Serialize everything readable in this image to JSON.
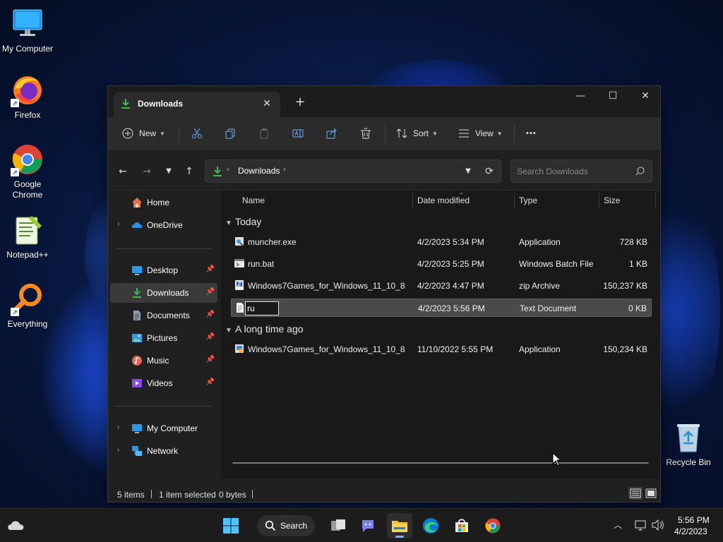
{
  "desktop": {
    "icons": [
      {
        "label": "My Computer"
      },
      {
        "label": "Firefox"
      },
      {
        "label": "Google Chrome"
      },
      {
        "label": "Notepad++"
      },
      {
        "label": "Everything"
      },
      {
        "label": "Recycle Bin"
      }
    ]
  },
  "explorer": {
    "tab_title": "Downloads",
    "tab_close": "✕",
    "new_tab": "+",
    "window_controls": {
      "minimize": "—",
      "maximize": "☐",
      "close": "✕"
    },
    "toolbar": {
      "new_label": "New",
      "sort_label": "Sort",
      "view_label": "View",
      "more_label": "•••"
    },
    "address": {
      "path": "Downloads",
      "search_placeholder": "Search Downloads"
    },
    "sidebar": {
      "items": [
        {
          "label": "Home",
          "icon": "home-icon"
        },
        {
          "label": "OneDrive",
          "icon": "cloud-icon"
        },
        {
          "label": "Desktop",
          "icon": "desktop-icon",
          "pinned": true
        },
        {
          "label": "Downloads",
          "icon": "download-icon",
          "pinned": true,
          "selected": true
        },
        {
          "label": "Documents",
          "icon": "document-icon",
          "pinned": true
        },
        {
          "label": "Pictures",
          "icon": "pictures-icon",
          "pinned": true
        },
        {
          "label": "Music",
          "icon": "music-icon",
          "pinned": true
        },
        {
          "label": "Videos",
          "icon": "videos-icon",
          "pinned": true
        },
        {
          "label": "My Computer",
          "icon": "computer-icon"
        },
        {
          "label": "Network",
          "icon": "network-icon"
        }
      ]
    },
    "columns": [
      "Name",
      "Date modified",
      "Type",
      "Size"
    ],
    "groups": [
      {
        "label": "Today",
        "rows": [
          {
            "name": "muncher.exe",
            "date": "4/2/2023 5:34 PM",
            "type": "Application",
            "size": "728 KB",
            "icon": "exe-icon"
          },
          {
            "name": "run.bat",
            "date": "4/2/2023 5:25 PM",
            "type": "Windows Batch File",
            "size": "1 KB",
            "icon": "batch-icon"
          },
          {
            "name": "Windows7Games_for_Windows_11_10_8....",
            "date": "4/2/2023 4:47 PM",
            "type": "zip Archive",
            "size": "150,237 KB",
            "icon": "zip-icon"
          },
          {
            "name": "ru",
            "date": "4/2/2023 5:56 PM",
            "type": "Text Document",
            "size": "0 KB",
            "icon": "text-file-icon",
            "selected": true,
            "renaming": true
          }
        ]
      },
      {
        "label": "A long time ago",
        "rows": [
          {
            "name": "Windows7Games_for_Windows_11_10_8....",
            "date": "11/10/2022 5:55 PM",
            "type": "Application",
            "size": "150,234 KB",
            "icon": "installer-icon"
          }
        ]
      }
    ],
    "status": {
      "items": "5 items",
      "selected": "1 item selected",
      "size": "0 bytes"
    }
  },
  "taskbar": {
    "search_label": "Search",
    "time": "5:56 PM",
    "date": "4/2/2023"
  },
  "colors": {
    "accent": "#0078d4",
    "download_green": "#3fb950",
    "folder_yellow": "#f2c744"
  }
}
